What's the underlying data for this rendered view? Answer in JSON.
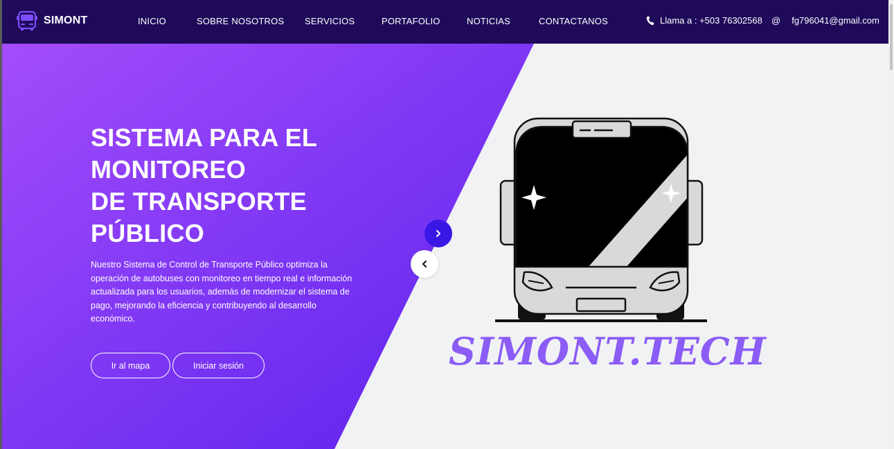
{
  "navbar": {
    "brand_name": "SIMONT",
    "links": [
      {
        "label": "INICIO"
      },
      {
        "label": "SOBRE NOSOTROS"
      },
      {
        "label": "SERVICIOS"
      },
      {
        "label": "PORTAFOLIO"
      },
      {
        "label": "NOTICIAS"
      },
      {
        "label": "CONTACTANOS"
      }
    ],
    "phone_text": "Llama a : +503 76302568",
    "email_symbol": "@",
    "email_text": "fg796041@gmail.com",
    "icons": {
      "logo": "bus-icon",
      "phone": "phone-icon"
    }
  },
  "hero": {
    "title_lines": [
      "SISTEMA PARA EL",
      "MONITOREO",
      "DE TRANSPORTE",
      "PÚBLICO"
    ],
    "description": "Nuestro Sistema de Control de Transporte Público optimiza la operación de autobuses con monitoreo en tiempo real e información actualizada para los usuarios, además de modernizar el sistema de pago, mejorando la eficiencia y contribuyendo al desarrollo económico.",
    "buttons": {
      "map": "Ir al mapa",
      "login": "Iniciar sesión"
    },
    "logo_text": "SIMONT.TECH",
    "icons": {
      "next": "chevron-right-icon",
      "prev": "chevron-left-icon",
      "illustration": "bus-front-icon"
    }
  },
  "colors": {
    "navbar_bg": "#1f0a5a",
    "hero_gradient_start": "#a34cfb",
    "hero_gradient_end": "#5a22ec",
    "accent": "#3b17e6",
    "logo_text": "#8b5cf6",
    "right_bg": "#f1f2f3"
  }
}
